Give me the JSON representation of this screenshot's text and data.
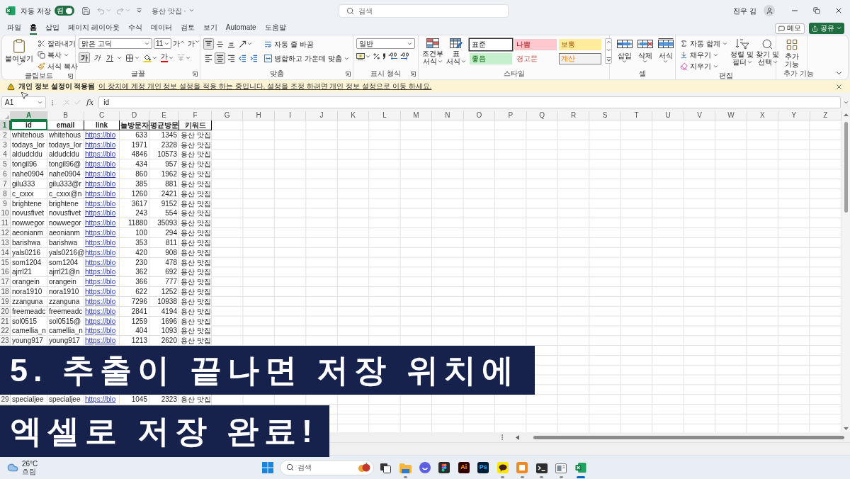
{
  "title_bar": {
    "autosave_label": "자동 저장",
    "autosave": {
      "on": true,
      "label": "켬"
    },
    "document_title": "용산 맛집 ·",
    "search": {
      "placeholder": "검색"
    },
    "user_name": "진우 김"
  },
  "ribbon_tabs": [
    {
      "label": "파일",
      "selected": false
    },
    {
      "label": "홈",
      "selected": true
    },
    {
      "label": "삽입",
      "selected": false
    },
    {
      "label": "페이지 레이아웃",
      "selected": false
    },
    {
      "label": "수식",
      "selected": false
    },
    {
      "label": "데이터",
      "selected": false
    },
    {
      "label": "검토",
      "selected": false
    },
    {
      "label": "보기",
      "selected": false
    },
    {
      "label": "Automate",
      "selected": false
    },
    {
      "label": "도움말",
      "selected": false
    }
  ],
  "ribbon_buttons": {
    "memo": "메모",
    "share": "공유"
  },
  "ribbon": {
    "clipboard": {
      "paste": "붙여넣기",
      "cut": "잘라내기",
      "copy": "복사",
      "format_painter": "서식 복사",
      "label": "클립보드"
    },
    "font": {
      "font_name": "맑은 고딕",
      "font_size": "11",
      "grow": "가",
      "shrink": "가",
      "styles": [
        {
          "kind": "bold",
          "label": "가",
          "selected": true
        },
        {
          "kind": "italic",
          "label": "가",
          "selected": false
        },
        {
          "kind": "underline",
          "label": "가",
          "selected": false
        }
      ],
      "font_color": "가",
      "label": "글꼴"
    },
    "alignment": {
      "top_row": [
        {
          "kind": "top",
          "selected": true
        },
        {
          "kind": "middle",
          "selected": false
        },
        {
          "kind": "bottom",
          "selected": false
        },
        {
          "kind": "orientation",
          "selected": false
        }
      ],
      "bottom_row": [
        {
          "kind": "left",
          "selected": false
        },
        {
          "kind": "center",
          "selected": true
        },
        {
          "kind": "right",
          "selected": false
        },
        {
          "kind": "outdent",
          "selected": false
        },
        {
          "kind": "indent",
          "selected": false
        }
      ],
      "wrap_text": "자동 줄 바꿈",
      "merge_center": "병합하고 가운데 맞춤",
      "label": "맞춤"
    },
    "number": {
      "format": "일반",
      "label": "표시 형식"
    },
    "styles": {
      "conditional": [
        "조건부",
        "서식"
      ],
      "table": [
        "표",
        "서식"
      ],
      "gallery": [
        {
          "kind": "normal",
          "label": "표준",
          "selected": true
        },
        {
          "kind": "bad",
          "label": "나쁨",
          "selected": false
        },
        {
          "kind": "neutral",
          "label": "보통",
          "selected": false
        },
        {
          "kind": "good",
          "label": "좋음",
          "selected": false
        },
        {
          "kind": "warning",
          "label": "경고문",
          "selected": false
        },
        {
          "kind": "calculation",
          "label": "계산",
          "selected": false
        }
      ],
      "label": "스타일"
    },
    "cells": {
      "buttons": [
        {
          "kind": "insert",
          "label": "삽입"
        },
        {
          "kind": "delete",
          "label": "삭제"
        },
        {
          "kind": "format",
          "label": "서식"
        }
      ],
      "label": "셀"
    },
    "editing": {
      "autosum": "자동 합계",
      "fill": "채우기",
      "clear": "지우기",
      "sort_filter": [
        "정렬 및",
        "필터"
      ],
      "find_select": [
        "찾기 및",
        "선택"
      ],
      "label": "편집"
    },
    "add_ins": {
      "button": [
        "추가",
        "기능"
      ],
      "label": "추가 기능"
    }
  },
  "info_bar": {
    "title": "개인 정보 설정이 적용됨",
    "message": "이 장치에 계정 개인 정보 설정을 적용 하는 중입니다. 설정을 조정 하려면 개인 정보 설정으로 이동 하세요."
  },
  "formula_bar": {
    "name_box": "A1",
    "edit_buttons_disabled": true,
    "function_button": "fx",
    "formula": "id"
  },
  "sheet": {
    "columns": [
      {
        "label": "A",
        "selected": true
      },
      {
        "label": "B",
        "selected": false
      },
      {
        "label": "C",
        "selected": false
      },
      {
        "label": "D",
        "selected": false
      },
      {
        "label": "E",
        "selected": false
      },
      {
        "label": "F",
        "selected": false
      },
      {
        "label": "G",
        "selected": false
      },
      {
        "label": "H",
        "selected": false
      },
      {
        "label": "I",
        "selected": false
      },
      {
        "label": "J",
        "selected": false
      },
      {
        "label": "K",
        "selected": false
      },
      {
        "label": "L",
        "selected": false
      },
      {
        "label": "M",
        "selected": false
      },
      {
        "label": "N",
        "selected": false
      },
      {
        "label": "O",
        "selected": false
      },
      {
        "label": "P",
        "selected": false
      },
      {
        "label": "Q",
        "selected": false
      },
      {
        "label": "R",
        "selected": false
      },
      {
        "label": "S",
        "selected": false
      },
      {
        "label": "T",
        "selected": false
      },
      {
        "label": "U",
        "selected": false
      },
      {
        "label": "V",
        "selected": false
      },
      {
        "label": "W",
        "selected": false
      },
      {
        "label": "X",
        "selected": false
      },
      {
        "label": "Y",
        "selected": false
      },
      {
        "label": "Z",
        "selected": false
      }
    ],
    "header_row": {
      "number": "1",
      "selected": true,
      "cells": [
        {
          "text": "id",
          "selected": true
        },
        {
          "text": "email",
          "selected": false
        },
        {
          "text": "link",
          "selected": false
        },
        {
          "text": "늘방문자",
          "selected": false
        },
        {
          "text": "평균방문",
          "selected": false
        },
        {
          "text": "키워드",
          "selected": false
        }
      ]
    },
    "rows": [
      {
        "number": "2",
        "selected": false,
        "id": "whitehous",
        "email": "whitehous",
        "link": "https://blo",
        "today_visitors": "633",
        "average_visitors": "1345",
        "keyword": "용산 맛집"
      },
      {
        "number": "3",
        "selected": false,
        "id": "todays_lor",
        "email": "todays_lor",
        "link": "https://blo",
        "today_visitors": "1971",
        "average_visitors": "2328",
        "keyword": "용산 맛집"
      },
      {
        "number": "4",
        "selected": false,
        "id": "aldudcldu",
        "email": "aldudcldu",
        "link": "https://blo",
        "today_visitors": "4846",
        "average_visitors": "10573",
        "keyword": "용산 맛집"
      },
      {
        "number": "5",
        "selected": false,
        "id": "tongil96",
        "email": "tongil96@",
        "link": "https://blo",
        "today_visitors": "434",
        "average_visitors": "957",
        "keyword": "용산 맛집"
      },
      {
        "number": "6",
        "selected": false,
        "id": "nahe0904",
        "email": "nahe0904",
        "link": "https://blo",
        "today_visitors": "860",
        "average_visitors": "1962",
        "keyword": "용산 맛집"
      },
      {
        "number": "7",
        "selected": false,
        "id": "gilu333",
        "email": "gilu333@r",
        "link": "https://blo",
        "today_visitors": "385",
        "average_visitors": "881",
        "keyword": "용산 맛집"
      },
      {
        "number": "8",
        "selected": false,
        "id": "c_cxxx",
        "email": "c_cxxx@n",
        "link": "https://blo",
        "today_visitors": "1260",
        "average_visitors": "2421",
        "keyword": "용산 맛집"
      },
      {
        "number": "9",
        "selected": false,
        "id": "brightene",
        "email": "brightene",
        "link": "https://blo",
        "today_visitors": "3617",
        "average_visitors": "9152",
        "keyword": "용산 맛집"
      },
      {
        "number": "10",
        "selected": false,
        "id": "novusfivet",
        "email": "novusfivet",
        "link": "https://blo",
        "today_visitors": "243",
        "average_visitors": "554",
        "keyword": "용산 맛집"
      },
      {
        "number": "11",
        "selected": false,
        "id": "nowwegor",
        "email": "nowwegor",
        "link": "https://blo",
        "today_visitors": "11880",
        "average_visitors": "35093",
        "keyword": "용산 맛집"
      },
      {
        "number": "12",
        "selected": false,
        "id": "aeonianm",
        "email": "aeonianm",
        "link": "https://blo",
        "today_visitors": "100",
        "average_visitors": "294",
        "keyword": "용산 맛집"
      },
      {
        "number": "13",
        "selected": false,
        "id": "barishwa",
        "email": "barishwa",
        "link": "https://blo",
        "today_visitors": "353",
        "average_visitors": "811",
        "keyword": "용산 맛집"
      },
      {
        "number": "14",
        "selected": false,
        "id": "yals0216",
        "email": "yals0216@",
        "link": "https://blo",
        "today_visitors": "420",
        "average_visitors": "908",
        "keyword": "용산 맛집"
      },
      {
        "number": "15",
        "selected": false,
        "id": "som1204",
        "email": "som1204",
        "link": "https://blo",
        "today_visitors": "230",
        "average_visitors": "478",
        "keyword": "용산 맛집"
      },
      {
        "number": "16",
        "selected": false,
        "id": "ajrrl21",
        "email": "ajrrl21@n",
        "link": "https://blo",
        "today_visitors": "362",
        "average_visitors": "692",
        "keyword": "용산 맛집"
      },
      {
        "number": "17",
        "selected": false,
        "id": "orangein",
        "email": "orangein",
        "link": "https://blo",
        "today_visitors": "366",
        "average_visitors": "777",
        "keyword": "용산 맛집"
      },
      {
        "number": "18",
        "selected": false,
        "id": "nora1910",
        "email": "nora1910",
        "link": "https://blo",
        "today_visitors": "622",
        "average_visitors": "1252",
        "keyword": "용산 맛집"
      },
      {
        "number": "19",
        "selected": false,
        "id": "zzanguna",
        "email": "zzanguna",
        "link": "https://blo",
        "today_visitors": "7296",
        "average_visitors": "10938",
        "keyword": "용산 맛집"
      },
      {
        "number": "20",
        "selected": false,
        "id": "freemeadc",
        "email": "freemeadc",
        "link": "https://blo",
        "today_visitors": "2841",
        "average_visitors": "4194",
        "keyword": "용산 맛집"
      },
      {
        "number": "21",
        "selected": false,
        "id": "sol0515",
        "email": "sol0515@",
        "link": "https://blo",
        "today_visitors": "1259",
        "average_visitors": "1696",
        "keyword": "용산 맛집"
      },
      {
        "number": "22",
        "selected": false,
        "id": "camellia_n",
        "email": "camellia_n",
        "link": "https://blo",
        "today_visitors": "404",
        "average_visitors": "1093",
        "keyword": "용산 맛집"
      },
      {
        "number": "23",
        "selected": false,
        "id": "young917",
        "email": "young917",
        "link": "https://blo",
        "today_visitors": "1213",
        "average_visitors": "2620",
        "keyword": "용산 맛집"
      }
    ],
    "rows_below_caption": [
      {
        "number": "29",
        "selected": false,
        "id": "specialjee",
        "email": "specialjee",
        "link": "https://blo",
        "today_visitors": "1045",
        "average_visitors": "2323",
        "keyword": "용산 맛집"
      }
    ]
  },
  "caption": {
    "lines": [
      "5. 추출이 끝나면 저장 위치에",
      "엑셀로 저장 완료!"
    ]
  },
  "taskbar": {
    "weather": {
      "temperature": "26°C",
      "condition": "흐림"
    },
    "search": {
      "placeholder": "검색"
    },
    "apps": [
      {
        "kind": "taskview",
        "running": false,
        "selected": false
      },
      {
        "kind": "explorer",
        "running": true,
        "selected": false
      },
      {
        "kind": "chat",
        "running": false,
        "selected": false
      },
      {
        "kind": "figma",
        "running": false,
        "selected": false
      },
      {
        "kind": "letters",
        "label": "Ai",
        "running": false,
        "selected": false
      },
      {
        "kind": "letters2",
        "label": "Ps",
        "running": false,
        "selected": false
      },
      {
        "kind": "talk",
        "running": true,
        "selected": false
      },
      {
        "kind": "tile",
        "running": true,
        "selected": false
      },
      {
        "kind": "terminal",
        "running": true,
        "selected": false
      },
      {
        "kind": "window",
        "running": true,
        "selected": false
      },
      {
        "kind": "excel",
        "running": true,
        "selected": true
      }
    ]
  }
}
